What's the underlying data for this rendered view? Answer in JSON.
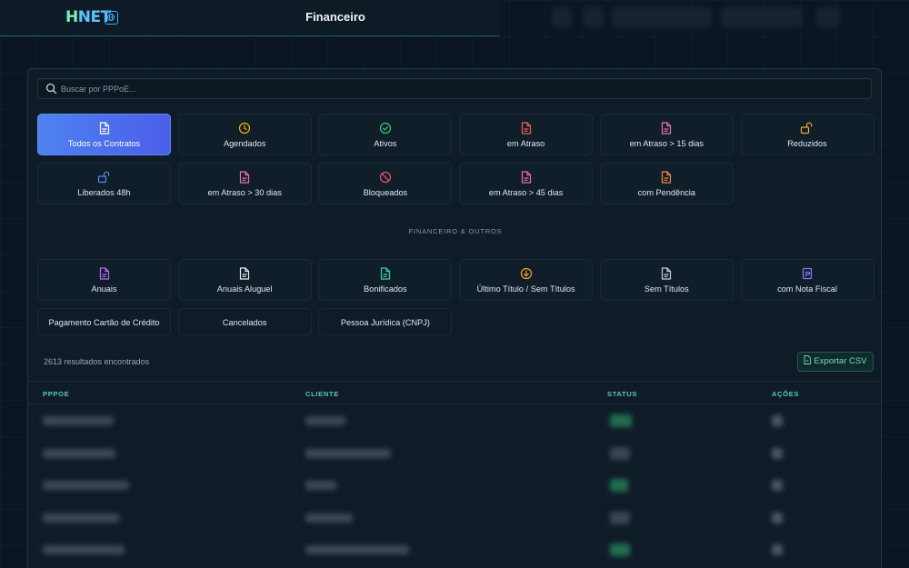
{
  "header": {
    "logo_h": "H",
    "logo_net": "NET",
    "title": "Financeiro"
  },
  "search": {
    "placeholder": "Buscar por PPPoE..."
  },
  "filters_primary": [
    {
      "label": "Todos os Contratos",
      "icon": "file-icon",
      "color": "#ffffff",
      "active": true
    },
    {
      "label": "Agendados",
      "icon": "clock-icon",
      "color": "#f5b400"
    },
    {
      "label": "Ativos",
      "icon": "check-circle-icon",
      "color": "#2fd07a"
    },
    {
      "label": "em Atraso",
      "icon": "file-icon",
      "color": "#f2605a"
    },
    {
      "label": "em Atraso > 15 dias",
      "icon": "file-icon",
      "color": "#f06ea8"
    },
    {
      "label": "Reduzidos",
      "icon": "unlock-icon",
      "color": "#f5a623"
    },
    {
      "label": "Liberados 48h",
      "icon": "unlock-icon",
      "color": "#4f8ff7"
    },
    {
      "label": "em Atraso > 30 dias",
      "icon": "file-icon",
      "color": "#f06ea8"
    },
    {
      "label": "Bloqueados",
      "icon": "ban-icon",
      "color": "#f0506a"
    },
    {
      "label": "em Atraso > 45 dias",
      "icon": "file-icon",
      "color": "#f06ea8"
    },
    {
      "label": "com Pendência",
      "icon": "file-icon",
      "color": "#f5853f"
    }
  ],
  "section_label": "FINANCEIRO & OUTROS",
  "filters_secondary": [
    {
      "label": "Anuais",
      "icon": "file-icon",
      "color": "#b46cf5"
    },
    {
      "label": "Anuais Aluguel",
      "icon": "file-icon",
      "color": "#e6edf2"
    },
    {
      "label": "Bonificados",
      "icon": "file-icon",
      "color": "#3fd0a0"
    },
    {
      "label": "Último Título / Sem Títulos",
      "icon": "arrow-down-circle-icon",
      "color": "#f5a623"
    },
    {
      "label": "Sem Títulos",
      "icon": "file-icon",
      "color": "#c8d2dc"
    },
    {
      "label": "com Nota Fiscal",
      "icon": "receipt-icon",
      "color": "#8a7cf7"
    },
    {
      "label": "Pagamento Cartão de Crédito"
    },
    {
      "label": "Cancelados"
    },
    {
      "label": "Pessoa Jurídica (CNPJ)"
    }
  ],
  "results_text": "2613 resultados encontrados",
  "export_label": "Exportar CSV",
  "table": {
    "columns": [
      "PPPOE",
      "CLIENTE",
      "STATUS",
      "AÇÕES"
    ]
  },
  "colors": {
    "accent": "#4e82f0",
    "teal": "#57c8c0",
    "background": "#0b1622"
  }
}
